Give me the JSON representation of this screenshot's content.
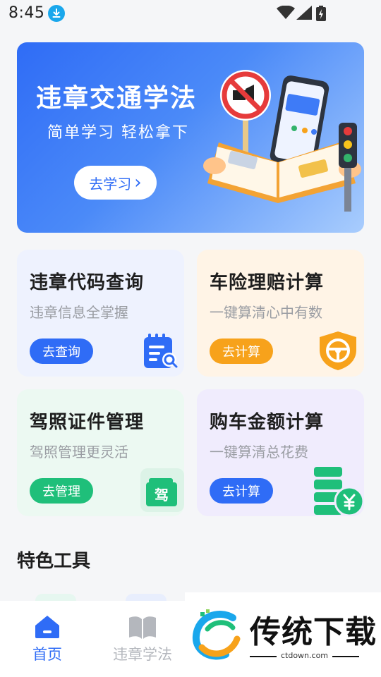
{
  "status_bar": {
    "time": "8:45",
    "icons": [
      "download-icon",
      "wifi-icon",
      "signal-icon",
      "battery-charging-icon"
    ]
  },
  "banner": {
    "title": "违章交通学法",
    "subtitle": "简单学习 轻松拿下",
    "button_label": "去学习",
    "button_arrow": "›",
    "accent": "#2f6cf6"
  },
  "cards": [
    {
      "title": "违章代码查询",
      "subtitle": "违章信息全掌握",
      "button_label": "去查询",
      "color": "#2f6cf6",
      "bg": "#eef2fe",
      "icon": "clipboard-search-icon"
    },
    {
      "title": "车险理赔计算",
      "subtitle": "一键算清心中有数",
      "button_label": "去计算",
      "color": "#f7a21b",
      "bg": "#fff4e6",
      "icon": "shield-steering-wheel-icon"
    },
    {
      "title": "驾照证件管理",
      "subtitle": "驾照管理更灵活",
      "button_label": "去管理",
      "color": "#1fbf7a",
      "bg": "#ecf9f2",
      "icon": "driver-license-icon"
    },
    {
      "title": "购车金额计算",
      "subtitle": "一键算清总花费",
      "button_label": "去计算",
      "color": "#2f6cf6",
      "bg": "#f0ecfd",
      "icon": "coins-yuan-icon"
    }
  ],
  "section": {
    "title": "特色工具"
  },
  "tabbar": {
    "tabs": [
      {
        "label": "首页",
        "icon": "home-icon",
        "active": true
      },
      {
        "label": "违章学法",
        "icon": "book-icon",
        "active": false
      }
    ],
    "active_color": "#2f6cf6",
    "inactive_color": "#b4b7bd"
  },
  "watermark": {
    "text": "传统下载",
    "url": "ctdown.com"
  }
}
